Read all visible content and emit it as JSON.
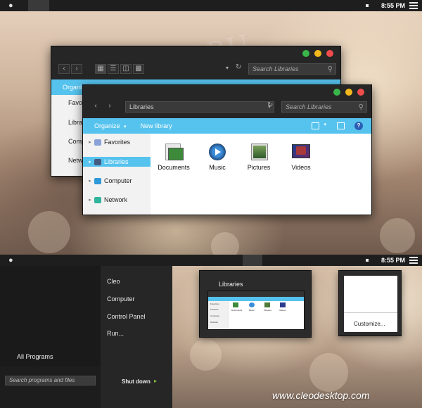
{
  "menubar": {
    "clock": "8:55 PM",
    "apple_icon": "apple-icon",
    "menu_icon": "list-icon"
  },
  "back_window": {
    "search_placeholder": "Search Libraries",
    "cmd_label": "Organize",
    "sidebar": [
      "Favorites",
      "Libraries",
      "Computer",
      "Network"
    ]
  },
  "front_window": {
    "address": "Libraries",
    "search_placeholder": "Search Libraries",
    "commands": {
      "organize": "Organize",
      "new_library": "New library"
    },
    "sidebar": [
      {
        "label": "Favorites",
        "icon": "star-icon",
        "selected": false
      },
      {
        "label": "Libraries",
        "icon": "library-icon",
        "selected": true
      },
      {
        "label": "Computer",
        "icon": "monitor-icon",
        "selected": false
      },
      {
        "label": "Network",
        "icon": "network-icon",
        "selected": false
      }
    ],
    "items": [
      {
        "label": "Documents",
        "icon": "documents-icon"
      },
      {
        "label": "Music",
        "icon": "music-icon"
      },
      {
        "label": "Pictures",
        "icon": "pictures-icon"
      },
      {
        "label": "Videos",
        "icon": "videos-icon"
      }
    ]
  },
  "menubar2": {
    "clock": "8:55 PM"
  },
  "start_menu": {
    "links": [
      "Cleo",
      "Computer",
      "Control Panel",
      "Run..."
    ],
    "all_programs": "All Programs",
    "search_placeholder": "Search programs and files",
    "shutdown": "Shut down"
  },
  "thumbnail_libraries": {
    "title": "Libraries",
    "sidebar": [
      "Favorites",
      "Libraries",
      "Computer",
      "Network"
    ],
    "items": [
      "Documents",
      "Music",
      "Pictures",
      "Videos"
    ]
  },
  "thumbnail_customize": {
    "label": "Customize..."
  },
  "watermark": "All4OS.RU",
  "website": "www.cleodesktop.com",
  "colors": {
    "accent": "#56c3ee",
    "chrome": "#262626",
    "green": "#3ab54a",
    "yellow": "#f2b81c",
    "red": "#ef4c4c"
  }
}
